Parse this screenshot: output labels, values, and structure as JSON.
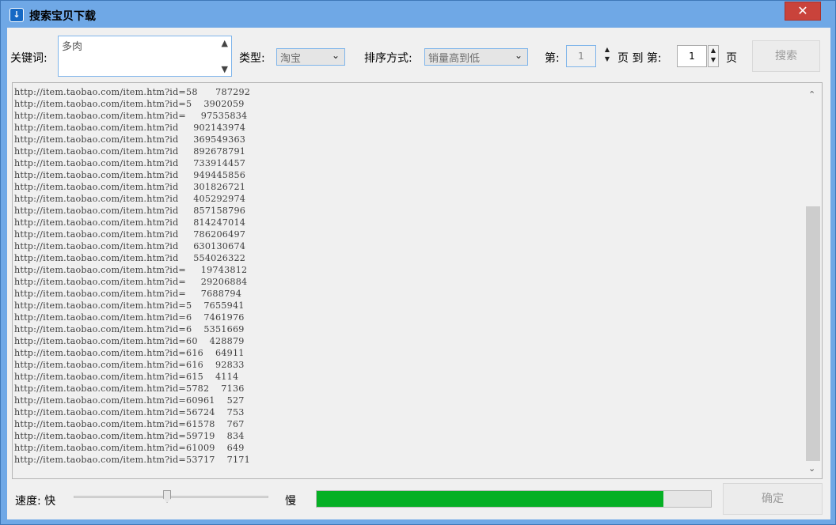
{
  "window": {
    "title": "搜索宝贝下载",
    "close_glyph": "✕"
  },
  "search": {
    "keyword_label": "关键词:",
    "keyword_value": "多肉",
    "type_label": "类型:",
    "type_value": "淘宝",
    "sort_label": "排序方式:",
    "sort_value": "销量高到低",
    "page_prefix": "第:",
    "page_from": "1",
    "page_to_label": "页 到 第:",
    "page_to": "1",
    "page_suffix": "页",
    "search_button": "搜索"
  },
  "results": {
    "items": [
      "http://item.taobao.com/item.htm?id=58      787292",
      "http://item.taobao.com/item.htm?id=5    3902059",
      "http://item.taobao.com/item.htm?id=     97535834",
      "http://item.taobao.com/item.htm?id     902143974",
      "http://item.taobao.com/item.htm?id     369549363",
      "http://item.taobao.com/item.htm?id     892678791",
      "http://item.taobao.com/item.htm?id     733914457",
      "http://item.taobao.com/item.htm?id     949445856",
      "http://item.taobao.com/item.htm?id     301826721",
      "http://item.taobao.com/item.htm?id     405292974",
      "http://item.taobao.com/item.htm?id     857158796",
      "http://item.taobao.com/item.htm?id     814247014",
      "http://item.taobao.com/item.htm?id     786206497",
      "http://item.taobao.com/item.htm?id     630130674",
      "http://item.taobao.com/item.htm?id     554026322",
      "http://item.taobao.com/item.htm?id=     19743812",
      "http://item.taobao.com/item.htm?id=     29206884",
      "http://item.taobao.com/item.htm?id=     7688794",
      "http://item.taobao.com/item.htm?id=5    7655941",
      "http://item.taobao.com/item.htm?id=6    7461976",
      "http://item.taobao.com/item.htm?id=6    5351669",
      "http://item.taobao.com/item.htm?id=60    428879",
      "http://item.taobao.com/item.htm?id=616    64911",
      "http://item.taobao.com/item.htm?id=616    92833",
      "http://item.taobao.com/item.htm?id=615    4114",
      "http://item.taobao.com/item.htm?id=5782    7136",
      "http://item.taobao.com/item.htm?id=60961    527",
      "http://item.taobao.com/item.htm?id=56724    753",
      "http://item.taobao.com/item.htm?id=61578    767",
      "http://item.taobao.com/item.htm?id=59719    834",
      "http://item.taobao.com/item.htm?id=61009    649",
      "http://item.taobao.com/item.htm?id=53717    7171"
    ]
  },
  "footer": {
    "speed_label": "速度: 快",
    "slow_label": "慢",
    "speed_value": 0.48,
    "progress_value": 0.88,
    "progress_color": "#06b025",
    "ok_button": "确定"
  }
}
